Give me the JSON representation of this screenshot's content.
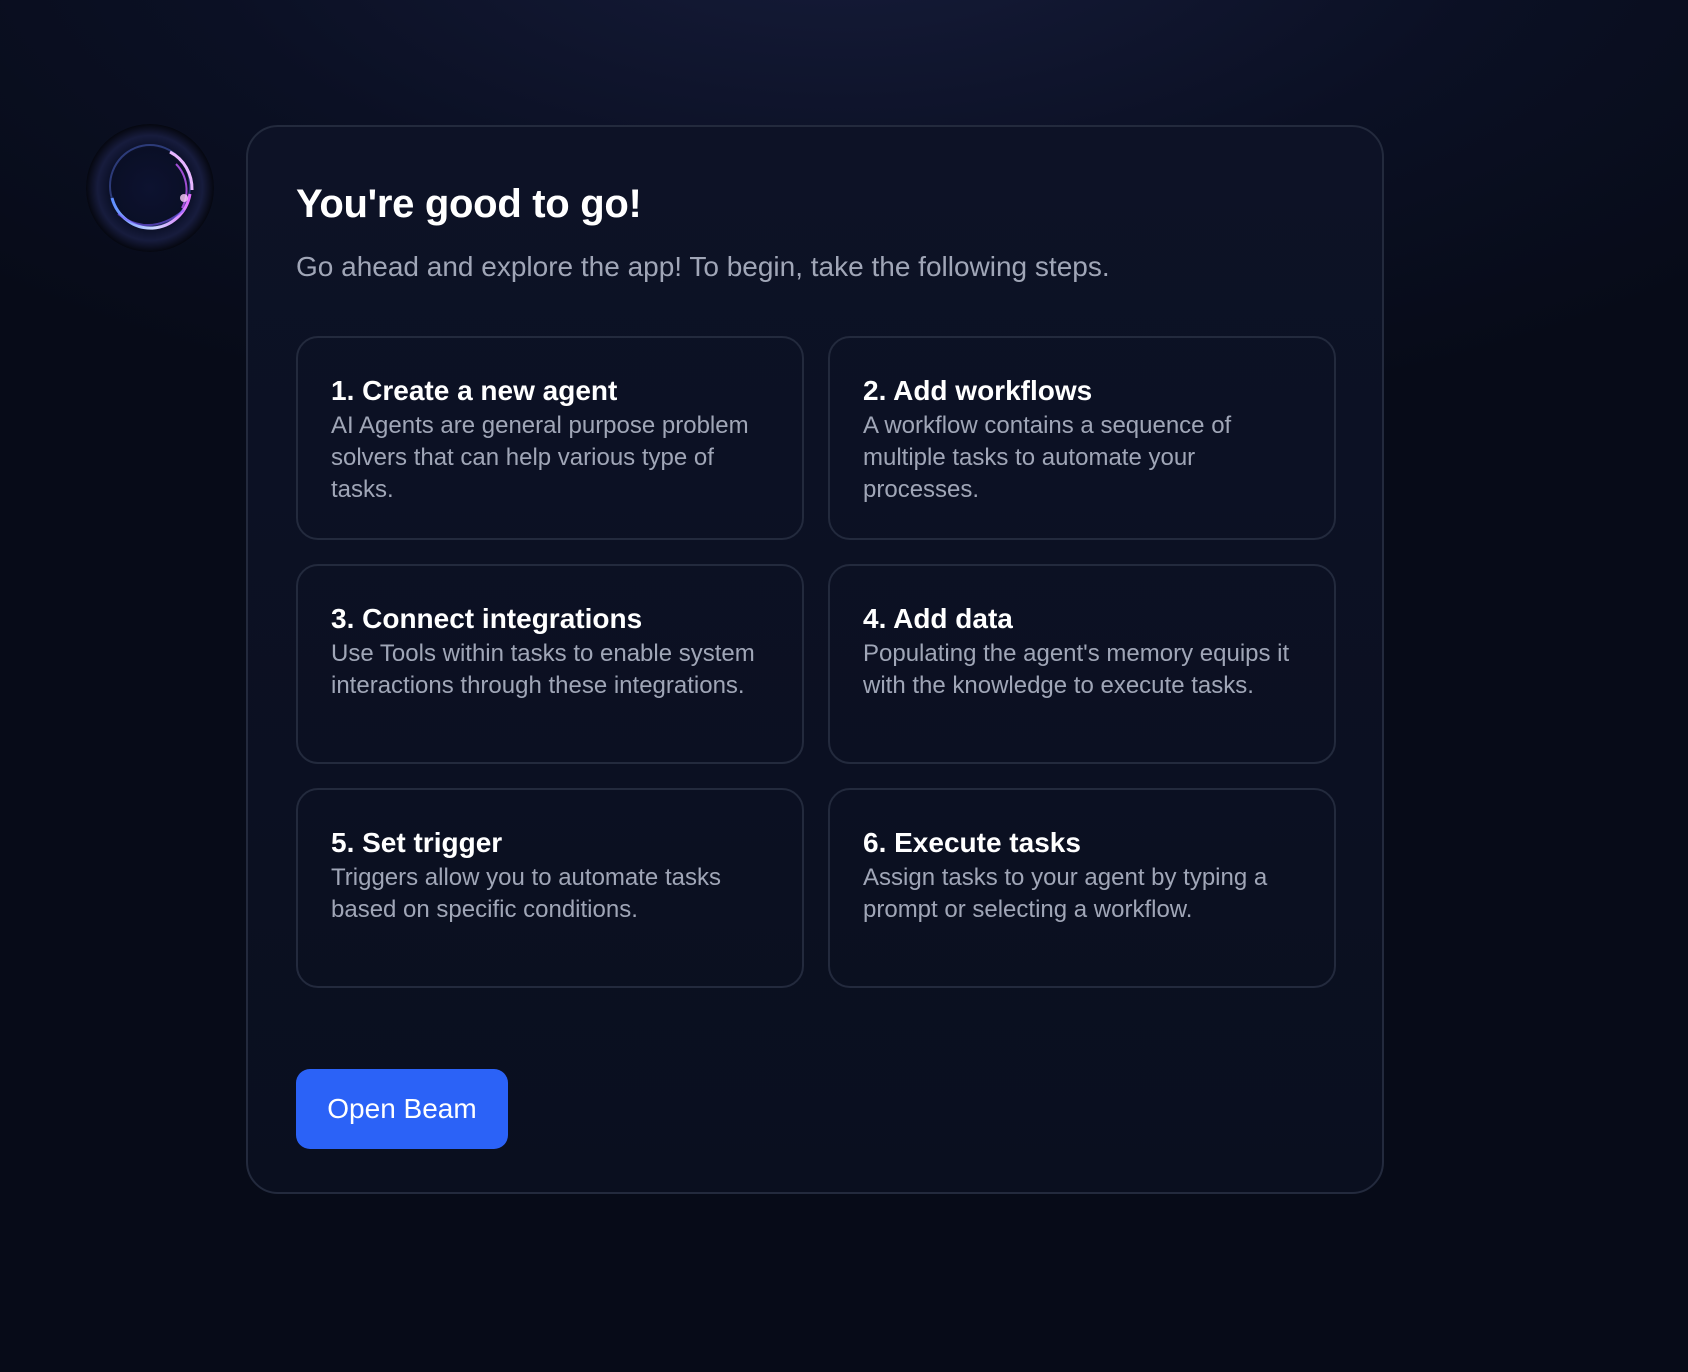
{
  "avatar": {
    "icon": "orb-avatar-icon"
  },
  "card": {
    "title": "You're good to go!",
    "subtitle": "Go ahead and explore the app! To begin, take the following steps."
  },
  "steps": [
    {
      "title": "1. Create a new agent",
      "description": "AI Agents are general purpose problem solvers that can help various type of tasks."
    },
    {
      "title": "2. Add workflows",
      "description": "A workflow contains a sequence of multiple tasks to automate your processes."
    },
    {
      "title": "3. Connect integrations",
      "description": "Use Tools within tasks to enable system interactions through these integrations."
    },
    {
      "title": "4. Add data",
      "description": "Populating the agent's memory equips it with the knowledge to execute tasks."
    },
    {
      "title": "5. Set trigger",
      "description": "Triggers allow you to automate tasks based on specific conditions."
    },
    {
      "title": "6. Execute tasks",
      "description": "Assign tasks to your agent by typing a prompt or selecting a workflow."
    }
  ],
  "button": {
    "label": "Open Beam"
  },
  "colors": {
    "accent": "#2b62f7",
    "background": "#0b1024",
    "card_border": "#232a3d",
    "muted_text": "#a0a6b7"
  }
}
